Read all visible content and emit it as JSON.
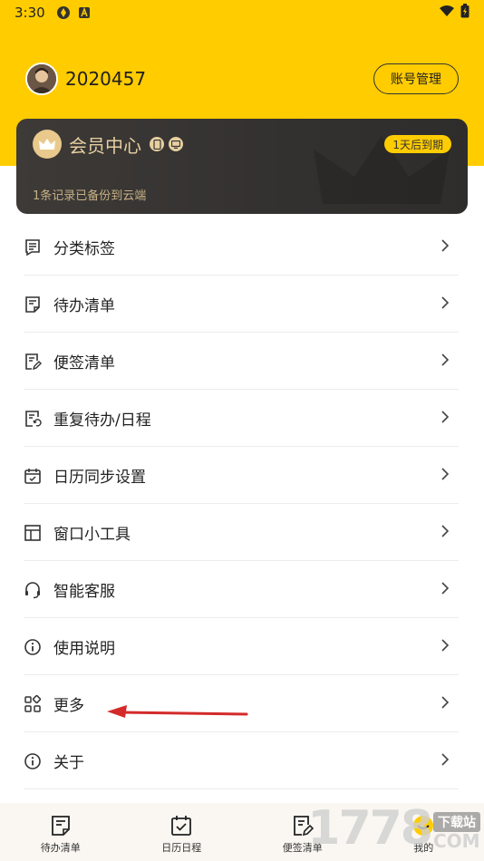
{
  "status_bar": {
    "time": "3:30"
  },
  "profile": {
    "username": "2020457",
    "account_button": "账号管理"
  },
  "vip": {
    "title": "会员中心",
    "expire_badge": "1天后到期",
    "backup_text": "1条记录已备份到云端"
  },
  "menu": {
    "items": [
      {
        "label": "分类标签",
        "icon": "tag-list-icon"
      },
      {
        "label": "待办清单",
        "icon": "todo-list-icon"
      },
      {
        "label": "便签清单",
        "icon": "note-list-icon"
      },
      {
        "label": "重复待办/日程",
        "icon": "repeat-icon"
      },
      {
        "label": "日历同步设置",
        "icon": "calendar-sync-icon"
      },
      {
        "label": "窗口小工具",
        "icon": "widget-icon"
      },
      {
        "label": "智能客服",
        "icon": "headset-icon"
      },
      {
        "label": "使用说明",
        "icon": "info-icon"
      },
      {
        "label": "更多",
        "icon": "grid-icon"
      },
      {
        "label": "关于",
        "icon": "about-icon"
      }
    ]
  },
  "bottom_nav": {
    "items": [
      {
        "label": "待办清单",
        "icon": "todo-tab-icon"
      },
      {
        "label": "日历日程",
        "icon": "calendar-tab-icon"
      },
      {
        "label": "便签清单",
        "icon": "note-tab-icon"
      },
      {
        "label": "我的",
        "icon": "profile-tab-icon"
      }
    ]
  },
  "watermark": {
    "number": "1778",
    "site": "下载站",
    "suffix": "COM"
  },
  "colors": {
    "brand_yellow": "#FFCC00",
    "vip_gold": "#E7CFA0",
    "annotation_red": "#D42A2A"
  }
}
